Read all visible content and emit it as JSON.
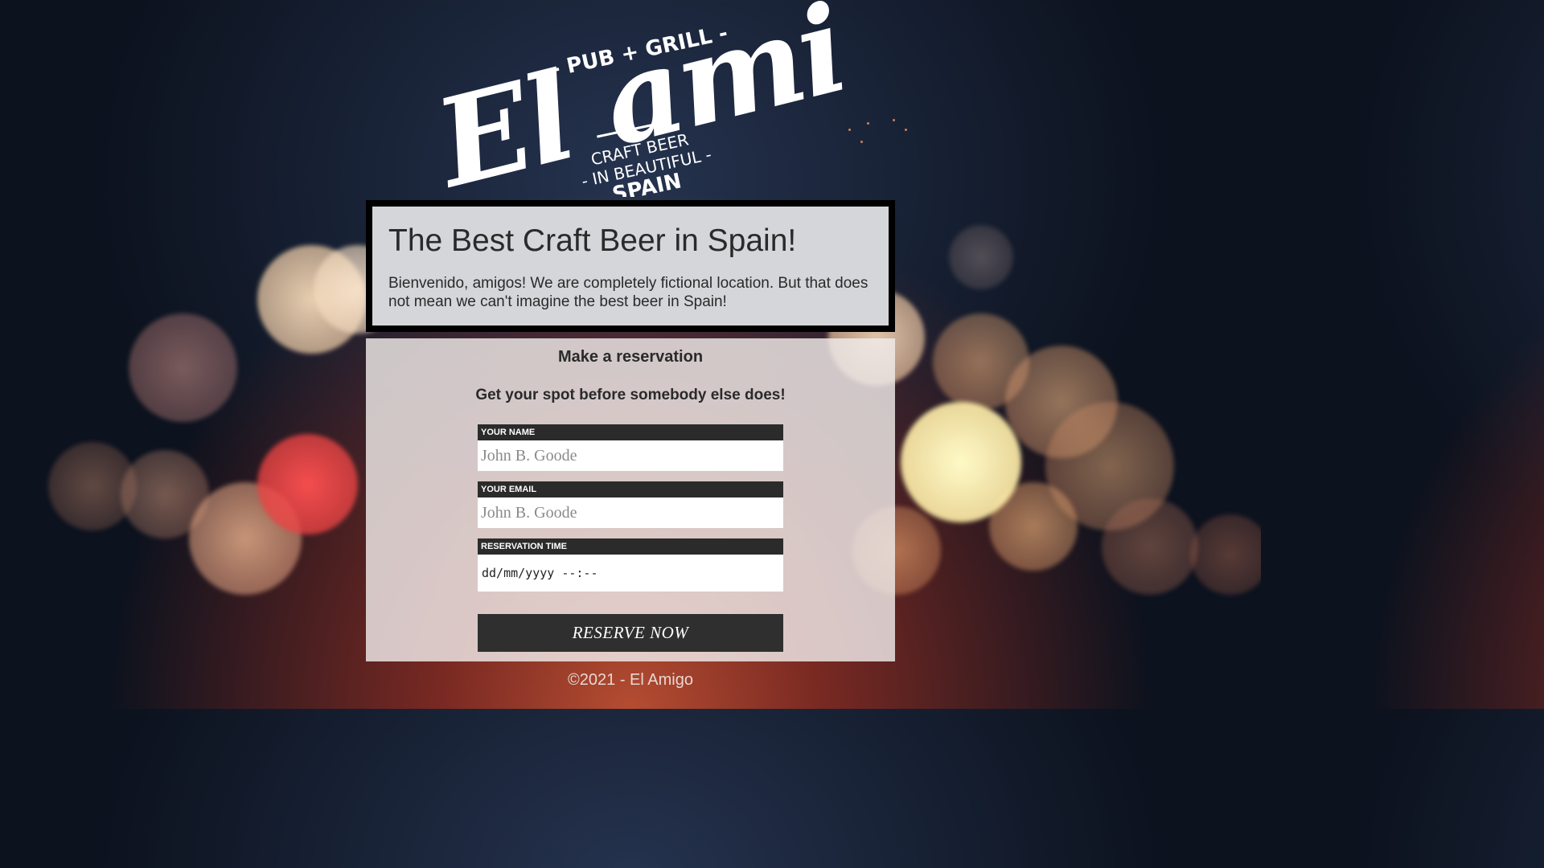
{
  "logo": {
    "brand": "El amigo",
    "tagline_top": "- PUB + GRILL -",
    "tagline_line1": "CRAFT BEER",
    "tagline_line2": "- IN BEAUTIFUL -",
    "tagline_line3": "SPAIN"
  },
  "hero": {
    "title": "The Best Craft Beer in Spain!",
    "text": "Bienvenido, amigos! We are completely fictional location. But that does not mean we can't imagine the best beer in Spain!"
  },
  "reservation": {
    "title": "Make a reservation",
    "subtitle": "Get your spot before somebody else does!",
    "name_label": "YOUR NAME",
    "name_placeholder": "John B. Goode",
    "email_label": "YOUR EMAIL",
    "email_placeholder": "John B. Goode",
    "time_label": "RESERVATION TIME",
    "time_placeholder": "dd/mm/yyyy --:--",
    "button_label": "RESERVE NOW"
  },
  "footer": {
    "text": "©2021 - El Amigo"
  },
  "colors": {
    "panel_dark": "#2b2b2b",
    "hero_border": "#000000",
    "button_bg": "#2f2f2f"
  }
}
